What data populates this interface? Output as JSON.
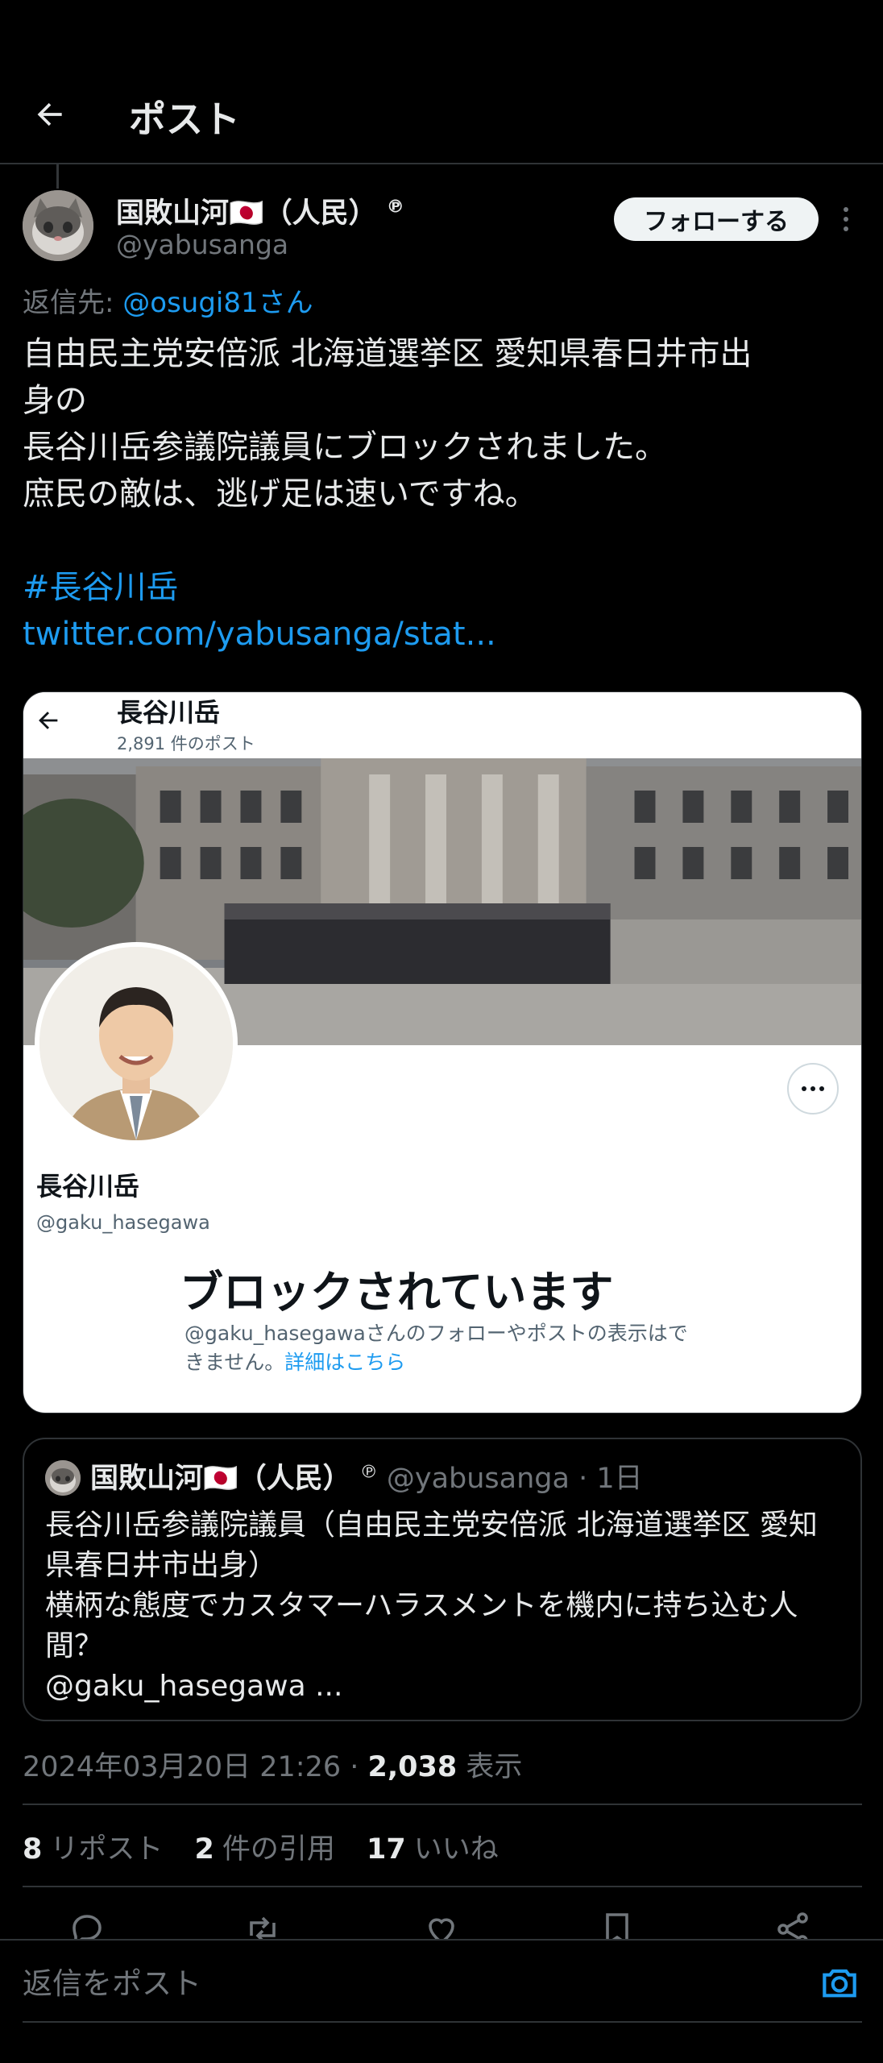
{
  "header": {
    "title": "ポスト"
  },
  "tweet": {
    "author_name": "国敗山河🇯🇵（人民）",
    "author_badge": "℗",
    "author_handle": "@yabusanga",
    "follow_label": "フォローする",
    "reply_to_prefix": "返信先:",
    "reply_to_mention": "@osugi81さん",
    "text_lines": [
      "自由民主党安倍派 北海道選挙区 愛知県春日井市出",
      "身の",
      "長谷川岳参議院議員にブロックされました。",
      "庶民の敵は、逃げ足は速いですね。"
    ],
    "hashtag": "#長谷川岳",
    "link": "twitter.com/yabusanga/stat..."
  },
  "media": {
    "profile_name": "長谷川岳",
    "post_count": "2,891 件のポスト",
    "profile_display_name": "長谷川岳",
    "profile_handle": "@gaku_hasegawa",
    "blocked_title": "ブロックされています",
    "blocked_desc_1": "@gaku_hasegawaさんのフォローやポストの表示はで",
    "blocked_desc_2": "きません。",
    "blocked_link": "詳細はこちら"
  },
  "quote": {
    "author_name": "国敗山河🇯🇵（人民）",
    "author_badge": "℗",
    "meta": "@yabusanga · 1日",
    "text_lines": [
      "長谷川岳参議院議員（自由民主党安倍派 北海道選挙区 愛知",
      "県春日井市出身）",
      "横柄な態度でカスタマーハラスメントを機内に持ち込む人",
      "間？",
      "@gaku_hasegawa ..."
    ]
  },
  "timestamp": {
    "datetime": "2024年03月20日 21:26 · ",
    "views_count": "2,038",
    "views_label": " 表示"
  },
  "stats": {
    "reposts_count": "8",
    "reposts_label": "リポスト",
    "quotes_count": "2",
    "quotes_label": "件の引用",
    "likes_count": "17",
    "likes_label": "いいね"
  },
  "reply": {
    "placeholder": "返信をポスト"
  },
  "icons": {
    "back": "arrow-left-icon",
    "more": "more-icon",
    "reply": "reply-icon",
    "repost": "repost-icon",
    "like": "heart-icon",
    "bookmark": "bookmark-icon",
    "share": "share-icon",
    "camera": "camera-icon"
  },
  "colors": {
    "background": "#000000",
    "text": "#e7e9ea",
    "muted": "#71767b",
    "accent": "#1d9bf0",
    "border": "#2f3336"
  }
}
